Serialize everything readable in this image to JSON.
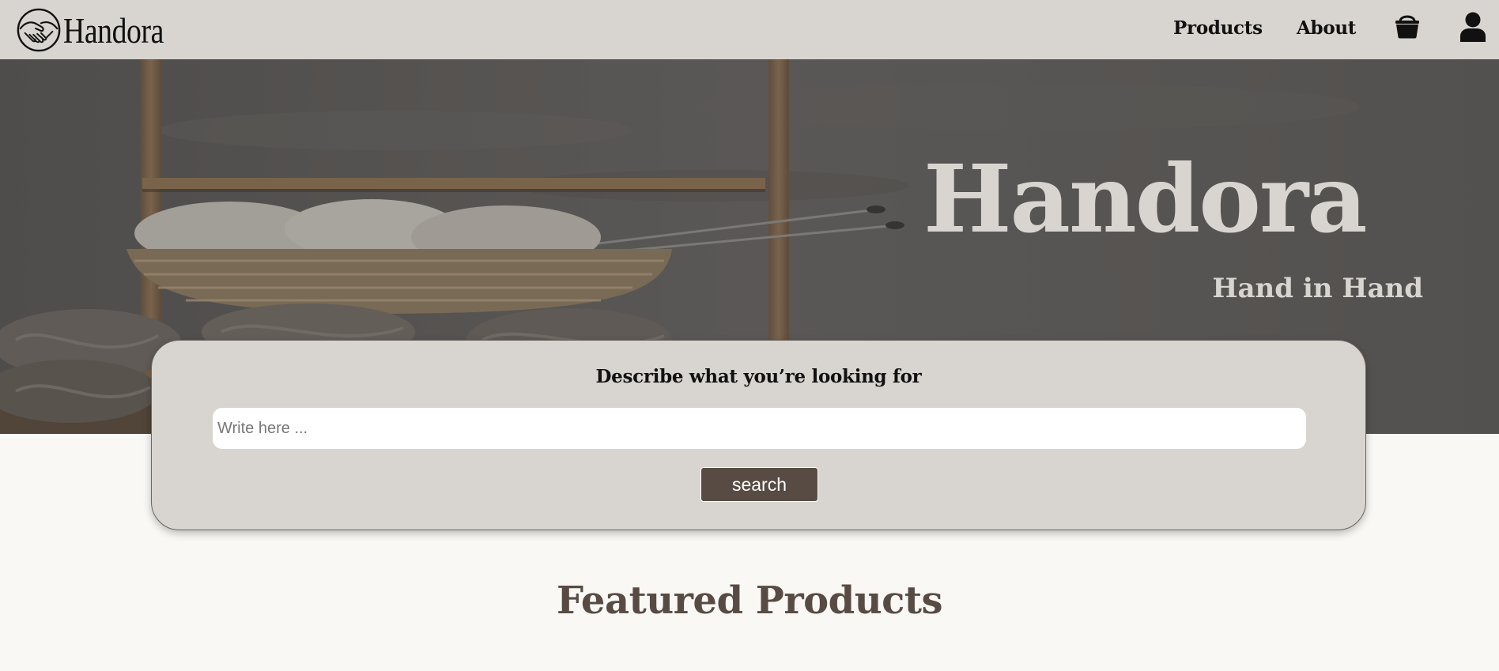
{
  "brand": {
    "name": "Handora"
  },
  "nav": {
    "products": "Products",
    "about": "About",
    "cart_icon": "basket-icon",
    "user_icon": "user-icon"
  },
  "hero": {
    "title": "Handora",
    "subtitle": "Hand in Hand",
    "image_icon": "yarn-basket-photo"
  },
  "search": {
    "label": "Describe what you’re looking for",
    "placeholder": "Write here ...",
    "value": "",
    "button": "search"
  },
  "featured": {
    "title": "Featured Products"
  },
  "colors": {
    "navbar_bg": "#d8d4cf",
    "accent_brown": "#574b43",
    "page_bg": "#f9f8f5",
    "hero_text": "#d8d4cf"
  }
}
